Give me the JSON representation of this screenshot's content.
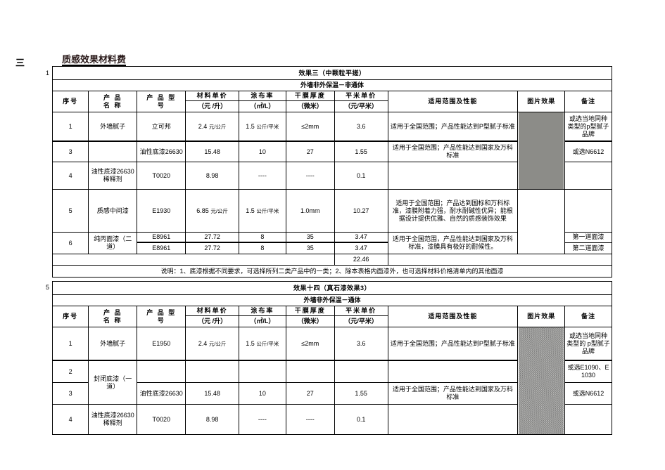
{
  "section": {
    "index_label": "三",
    "title": "质感效果材料费"
  },
  "gutter": {
    "row_marker_1": "1",
    "row_marker_5": "5"
  },
  "columns": {
    "seq": "序号",
    "product_name": "产 品\n名  称",
    "product_name_l1": "产  品",
    "product_name_l2": "名  称",
    "product_model_l1": "产 品 型",
    "product_model_l2": "号",
    "unit_price": "材料单价",
    "unit_price_unit": "（元 /升）",
    "coverage": "涂布率",
    "coverage_unit": "（㎡/L）",
    "dry_thickness": "干膜厚度",
    "dry_thickness_unit": "（微米）",
    "sqm_price": "平米单价",
    "sqm_price_unit": "（元/平米）",
    "scope": "适用范围及性能",
    "picture": "图片效果",
    "remark": "备注"
  },
  "tables": [
    {
      "id": "effect-3",
      "title": "效果三（中颗粒平搓）",
      "title_color": "#1a1a1a",
      "subtitle": "外墙非外保温－非通体",
      "subtitle_color": "#1a1a1a",
      "rows": [
        {
          "seq": "1",
          "name": "外墙腻子",
          "model": "立可邦",
          "price_main": "2.4",
          "price_unit": "元/公斤",
          "coverage_main": "1.5",
          "coverage_unit": "公斤/平米",
          "thickness": "≤2mm",
          "sqm": "3.6",
          "scope": "适用于全国范围；产品性能达到P型腻子标准",
          "remark": "或选当地同种类型的p型腻子品牌"
        },
        {
          "seq": "3",
          "name": "",
          "model": "油性底漆26630",
          "price_main": "15.48",
          "price_unit": "",
          "coverage_main": "10",
          "coverage_unit": "",
          "thickness": "27",
          "sqm": "1.55",
          "scope": "适用于全国范围；产品性能达到国家及万科标准",
          "remark": "或选N6612"
        },
        {
          "seq": "4",
          "name": "油性底漆26630 稀释剂",
          "model": "T0020",
          "price_main": "8.98",
          "price_unit": "",
          "coverage_main": "----",
          "coverage_unit": "",
          "thickness": "----",
          "sqm": "0.1",
          "scope": "",
          "remark": ""
        },
        {
          "seq": "5",
          "name": "质感中间漆",
          "model": "E1930",
          "price_main": "6.85",
          "price_unit": "元/公斤",
          "coverage_main": "1.5",
          "coverage_unit": "公斤/平米",
          "thickness": "1.0mm",
          "sqm": "10.27",
          "scope": "适用于全国范围；产品达到国标和万科标准，漆膜附着力强，耐水耐碱性优异；能根据设计提供优雅、自然的质感装饰效果",
          "remark": ""
        },
        {
          "seq": "6",
          "name": "纯丙面漆（二道）",
          "model": "E8961",
          "price_main": "27.72",
          "price_unit": "",
          "coverage_main": "8",
          "coverage_unit": "",
          "thickness": "35",
          "sqm": "3.47",
          "scope": "适用于全国范围，产品性能达到国家及万科标准，漆膜具有极好的耐候性。",
          "remark": "第一道面漆"
        },
        {
          "seq": "",
          "name": "",
          "model": "E8961",
          "price_main": "27.72",
          "price_unit": "",
          "coverage_main": "8",
          "coverage_unit": "",
          "thickness": "35",
          "sqm": "3.47",
          "scope": "",
          "remark": "第二道面漆"
        }
      ],
      "total": "22.46",
      "note": "说明：1、底漆根据不同要求，可选择所列二类产品中的一类；2、除本表格内面漆外，也可选择材料价格清单内的其他面漆",
      "swatch": "flat-gray"
    },
    {
      "id": "effect-14",
      "title": "效果十四（真石漆效果3）",
      "title_color": "#cc0000",
      "subtitle": "外墙非外保温－通体",
      "subtitle_color": "#cc0000",
      "rows": [
        {
          "seq": "1",
          "name": "外墙腻子",
          "model": "E1950",
          "price_main": "2.4",
          "price_unit": "元/公斤",
          "coverage_main": "1.5",
          "coverage_unit": "公斤/平米",
          "thickness": "≤2mm",
          "sqm": "3.6",
          "scope": "适用于全国范围；产品性能达到P型腻子标准",
          "remark": "或选当地同种类型的 p型腻子品牌"
        },
        {
          "seq": "2",
          "name": "封闭底漆（一道）",
          "model": "",
          "price_main": "",
          "price_unit": "",
          "coverage_main": "",
          "coverage_unit": "",
          "thickness": "",
          "sqm": "",
          "scope": "",
          "remark": "或选E1090、E1030"
        },
        {
          "seq": "3",
          "name": "",
          "model": "油性底漆26630",
          "price_main": "15.48",
          "price_unit": "",
          "coverage_main": "10",
          "coverage_unit": "",
          "thickness": "27",
          "sqm": "1.55",
          "scope": "适用于全国范围；产品性能达到国家及万科标准",
          "remark": "或选N6612"
        },
        {
          "seq": "4",
          "name": "油性底漆26630 稀释剂",
          "model": "T0020",
          "price_main": "8.98",
          "price_unit": "",
          "coverage_main": "----",
          "coverage_unit": "",
          "thickness": "----",
          "sqm": "0.1",
          "scope": "",
          "remark": ""
        }
      ],
      "swatch": "stone-gray"
    }
  ]
}
